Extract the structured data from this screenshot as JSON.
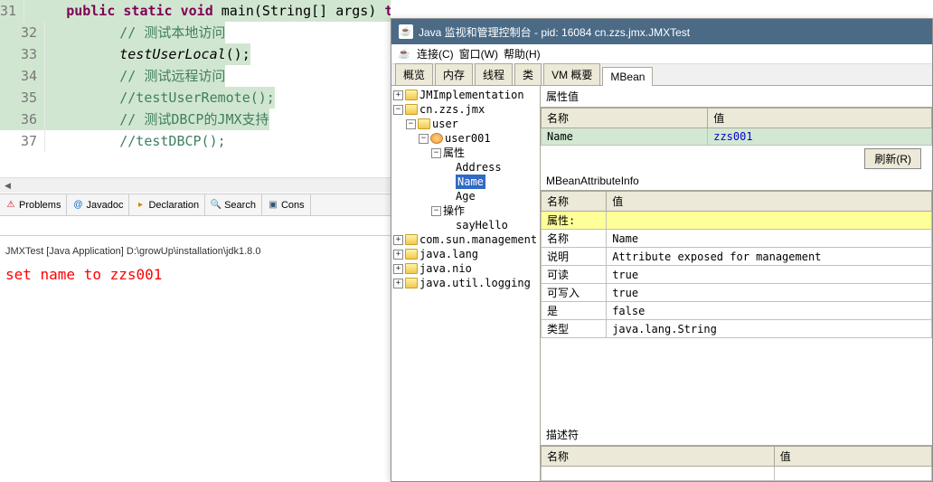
{
  "editor": {
    "lines": [
      {
        "num": "31",
        "cls": "hl",
        "html": "    <span class='kw'>public</span> <span class='kw'>static</span> <span class='kw'>void</span> main(String[] args) <span class='kw'>throws</span> Exception {"
      },
      {
        "num": "32",
        "cls": "hl",
        "html": "        <span class='cm'>// 测试本地访问</span>"
      },
      {
        "num": "33",
        "cls": "hl",
        "html": "        <i>testUserLocal</i>();"
      },
      {
        "num": "34",
        "cls": "hl",
        "html": "        <span class='cm'>// 测试远程访问</span>"
      },
      {
        "num": "35",
        "cls": "hl",
        "html": "        <span class='cm'>//testUserRemote();</span>"
      },
      {
        "num": "36",
        "cls": "hl",
        "html": "        <span class='cm'>// 测试DBCP的JMX支持</span>"
      },
      {
        "num": "37",
        "cls": "",
        "html": "        <span class='cm'>//testDBCP();</span>"
      }
    ]
  },
  "tabs": [
    {
      "icon": "⚠",
      "color": "#c00",
      "label": "Problems"
    },
    {
      "icon": "@",
      "color": "#06c",
      "label": "Javadoc"
    },
    {
      "icon": "▸",
      "color": "#c80",
      "label": "Declaration"
    },
    {
      "icon": "🔍",
      "color": "#333",
      "label": "Search"
    },
    {
      "icon": "▣",
      "color": "#357",
      "label": "Cons"
    }
  ],
  "run_line": "JMXTest [Java Application] D:\\growUp\\installation\\jdk1.8.0",
  "console_out": "set name to zzs001",
  "jc": {
    "title": "Java 监视和管理控制台 - pid: 16084 cn.zzs.jmx.JMXTest",
    "menus": [
      "连接(C)",
      "窗口(W)",
      "帮助(H)"
    ],
    "tabs": [
      "概览",
      "内存",
      "线程",
      "类",
      "VM 概要",
      "MBean"
    ],
    "active_tab": 5,
    "tree": [
      {
        "ind": 0,
        "tog": "+",
        "icon": "folder",
        "label": "JMImplementation"
      },
      {
        "ind": 0,
        "tog": "-",
        "icon": "folder",
        "label": "cn.zzs.jmx"
      },
      {
        "ind": 1,
        "tog": "-",
        "icon": "folder",
        "label": "user"
      },
      {
        "ind": 2,
        "tog": "-",
        "icon": "bean",
        "label": "user001"
      },
      {
        "ind": 3,
        "tog": "-",
        "icon": "",
        "label": "属性"
      },
      {
        "ind": 4,
        "tog": "",
        "icon": "",
        "label": "Address"
      },
      {
        "ind": 4,
        "tog": "",
        "icon": "",
        "label": "Name",
        "sel": true
      },
      {
        "ind": 4,
        "tog": "",
        "icon": "",
        "label": "Age"
      },
      {
        "ind": 3,
        "tog": "-",
        "icon": "",
        "label": "操作"
      },
      {
        "ind": 4,
        "tog": "",
        "icon": "",
        "label": "sayHello"
      },
      {
        "ind": 0,
        "tog": "+",
        "icon": "folder",
        "label": "com.sun.management"
      },
      {
        "ind": 0,
        "tog": "+",
        "icon": "folder",
        "label": "java.lang"
      },
      {
        "ind": 0,
        "tog": "+",
        "icon": "folder",
        "label": "java.nio"
      },
      {
        "ind": 0,
        "tog": "+",
        "icon": "folder",
        "label": "java.util.logging"
      }
    ],
    "attr_section": "属性值",
    "attr_header": [
      "名称",
      "值"
    ],
    "attr_row": [
      "Name",
      "zzs001"
    ],
    "refresh": "刷新(R)",
    "info_section": "MBeanAttributeInfo",
    "info_header": [
      "名称",
      "值"
    ],
    "info_rows": [
      {
        "k": "属性:",
        "v": "",
        "hl": true
      },
      {
        "k": "名称",
        "v": "Name"
      },
      {
        "k": "说明",
        "v": "Attribute exposed for management"
      },
      {
        "k": "可读",
        "v": "true"
      },
      {
        "k": "可写入",
        "v": "true"
      },
      {
        "k": "是",
        "v": "false"
      },
      {
        "k": "类型",
        "v": "java.lang.String"
      }
    ],
    "desc_section": "描述符",
    "desc_header": [
      "名称",
      "值"
    ]
  }
}
